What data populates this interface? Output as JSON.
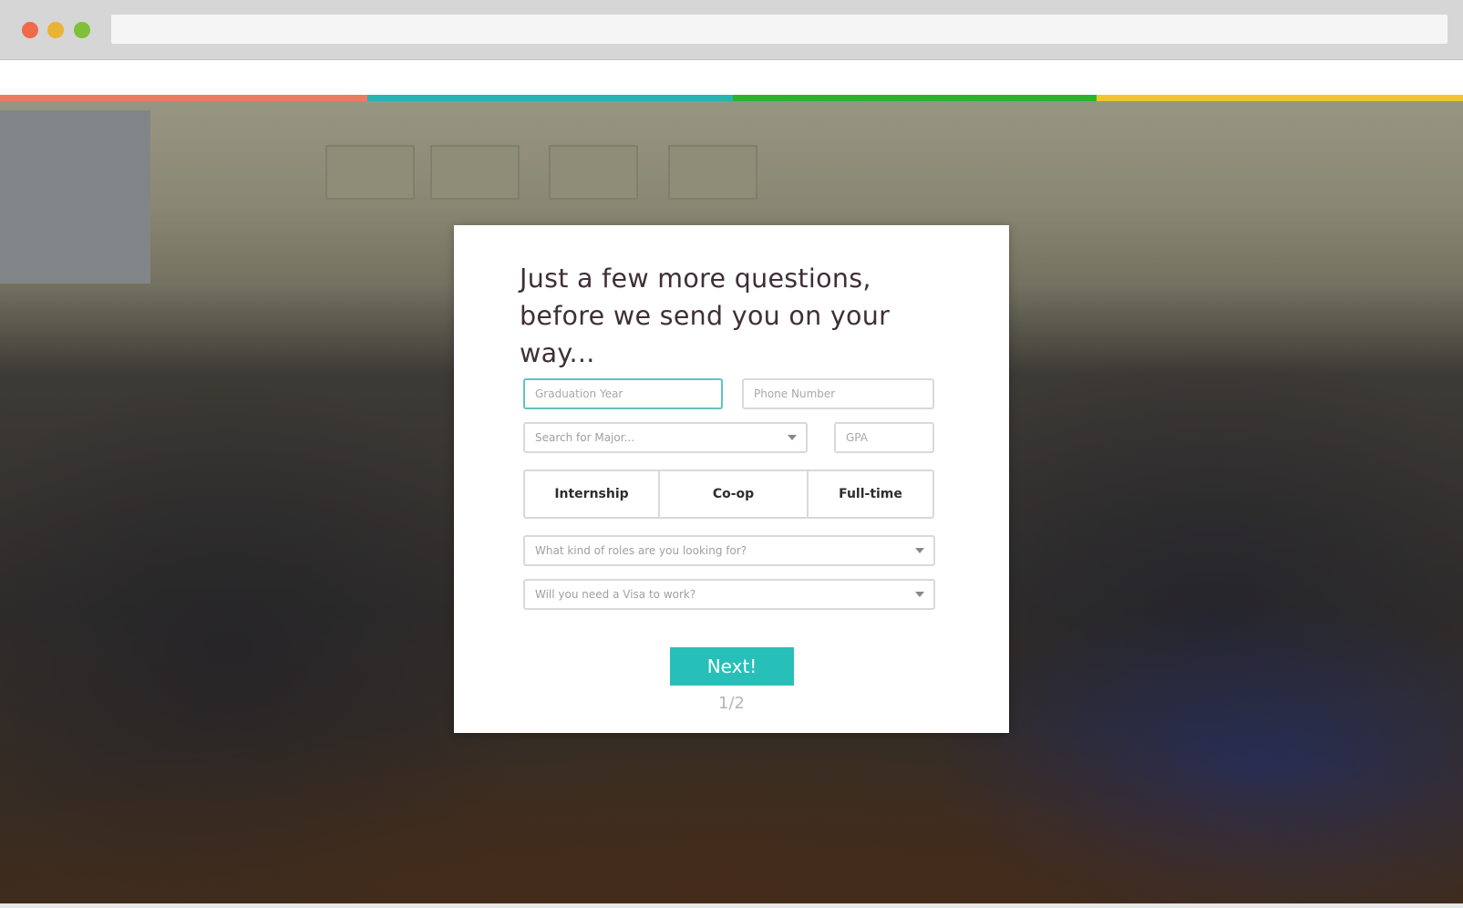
{
  "browser": {
    "address": ""
  },
  "colors": {
    "bar": [
      "#ef7a62",
      "#22b8b0",
      "#2ab42e",
      "#f0c62e"
    ],
    "accent": "#27c0b9"
  },
  "form": {
    "headline": "Just a few more questions, before we send you on your way...",
    "graduation_year_placeholder": "Graduation Year",
    "phone_placeholder": "Phone Number",
    "major_placeholder": "Search for Major...",
    "gpa_placeholder": "GPA",
    "job_types": [
      "Internship",
      "Co-op",
      "Full-time"
    ],
    "roles_placeholder": "What kind of roles are you looking for?",
    "visa_placeholder": "Will you need a Visa to work?",
    "next_label": "Next!",
    "step": "1/2"
  }
}
